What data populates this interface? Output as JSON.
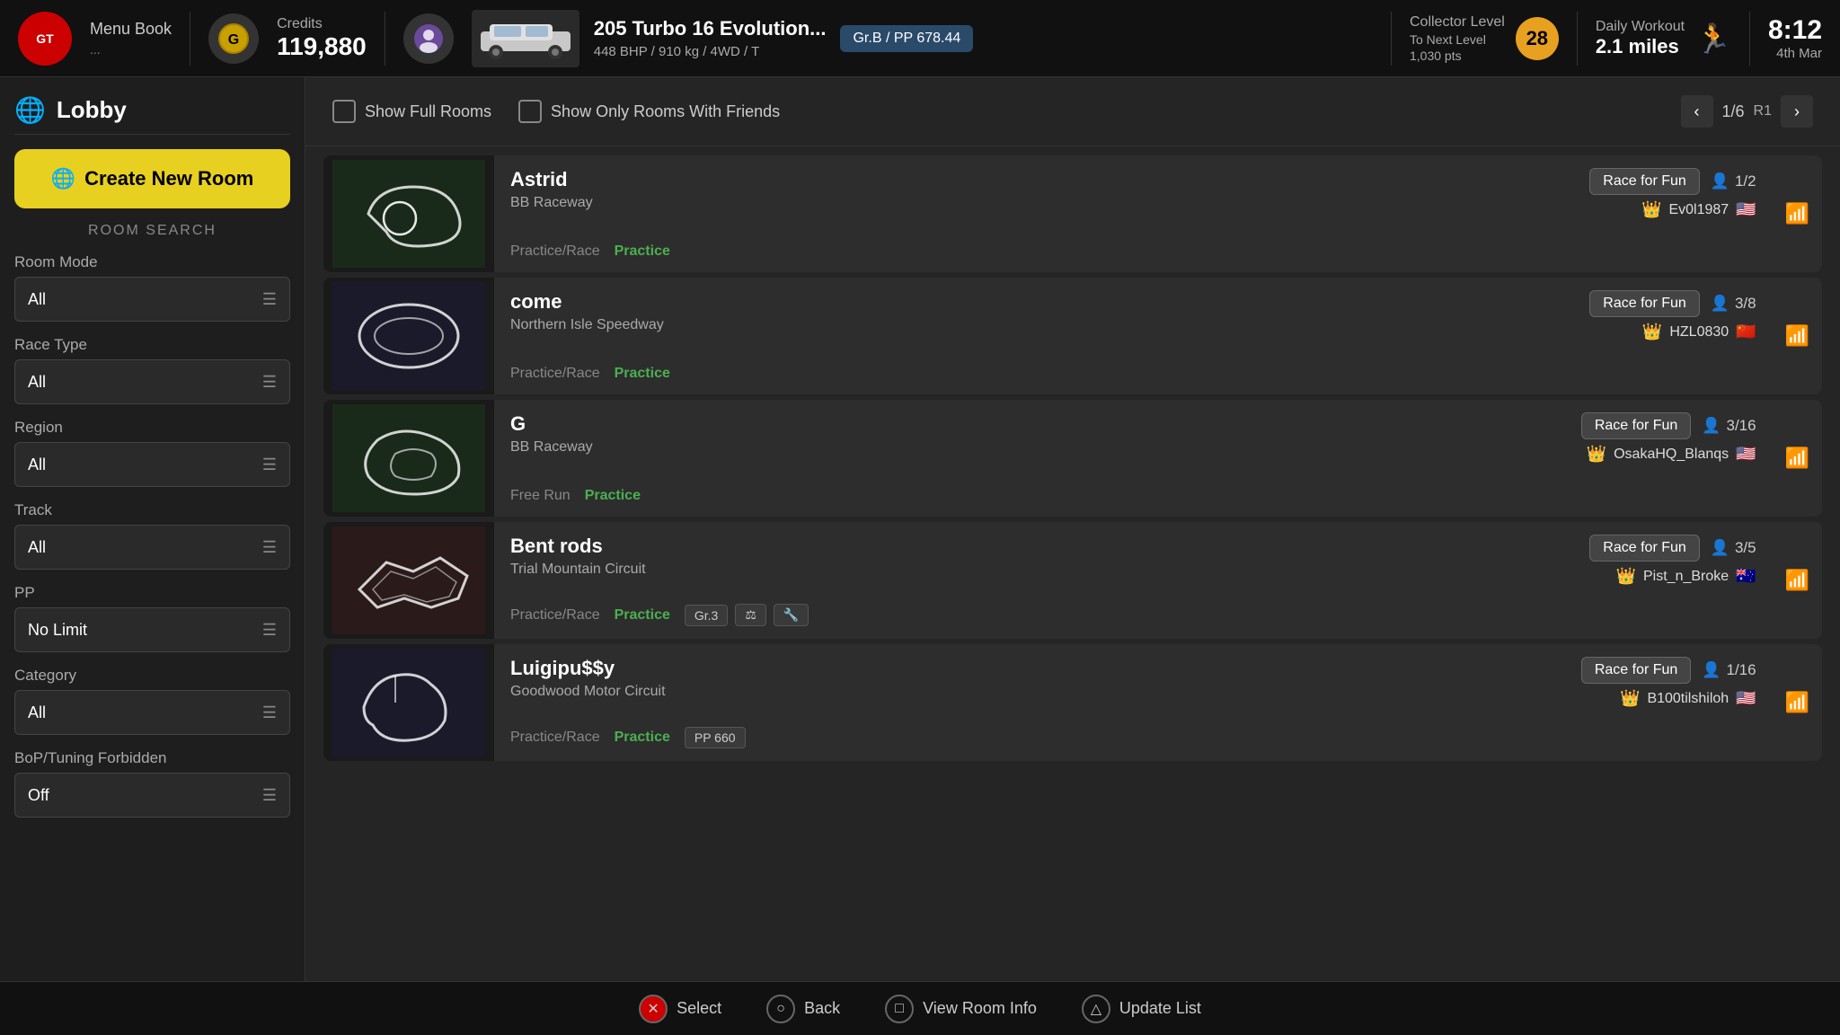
{
  "topbar": {
    "logo": "GT",
    "menu_label": "Menu Book",
    "menu_dots": "...",
    "credits_label": "Credits",
    "credits_value": "119,880",
    "car_name": "205 Turbo 16 Evolution...",
    "car_specs": "448 BHP / 910 kg / 4WD / T",
    "car_grade": "Gr.B / PP 678.44",
    "collector_label": "Collector Level",
    "collector_next": "To Next Level",
    "collector_level": "28",
    "collector_pts": "1,030 pts",
    "workout_label": "Daily Workout",
    "workout_miles": "2.1 miles",
    "workout_date": "4th Mar",
    "time": "8:12"
  },
  "sidebar": {
    "lobby_label": "Lobby",
    "create_room_label": "Create New Room",
    "room_search_label": "ROOM SEARCH",
    "filters": [
      {
        "label": "Room Mode",
        "value": "All"
      },
      {
        "label": "Race Type",
        "value": "All"
      },
      {
        "label": "Region",
        "value": "All"
      },
      {
        "label": "Track",
        "value": "All"
      },
      {
        "label": "PP",
        "value": "No Limit"
      },
      {
        "label": "Category",
        "value": "All"
      },
      {
        "label": "BoP/Tuning Forbidden",
        "value": "Off"
      }
    ]
  },
  "content": {
    "show_full_rooms": "Show Full Rooms",
    "show_friends": "Show Only Rooms With Friends",
    "pagination": "1/6",
    "page_r": "R1",
    "rooms": [
      {
        "name": "Astrid",
        "track": "BB Raceway",
        "type": "Race for Fun",
        "players": "1/2",
        "host": "Ev0l1987",
        "mode": "Practice/Race",
        "status": "Practice",
        "tags": [],
        "flag": "🇺🇸"
      },
      {
        "name": "come",
        "track": "Northern Isle Speedway",
        "type": "Race for Fun",
        "players": "3/8",
        "host": "HZL0830",
        "mode": "Practice/Race",
        "status": "Practice",
        "tags": [],
        "flag": "🇨🇳"
      },
      {
        "name": "G",
        "track": "BB Raceway",
        "type": "Race for Fun",
        "players": "3/16",
        "host": "OsakaHQ_Blanqs",
        "mode": "Free Run",
        "status": "Practice",
        "tags": [],
        "flag": "🇺🇸"
      },
      {
        "name": "Bent rods",
        "track": "Trial Mountain Circuit",
        "type": "Race for Fun",
        "players": "3/5",
        "host": "Pist_n_Broke",
        "mode": "Practice/Race",
        "status": "Practice",
        "tags": [
          "Gr.3",
          "⚖",
          "🔧"
        ],
        "flag": "🇦🇺"
      },
      {
        "name": "Luigipu$$y",
        "track": "Goodwood Motor Circuit",
        "type": "Race for Fun",
        "players": "1/16",
        "host": "B100tilshiloh",
        "mode": "Practice/Race",
        "status": "Practice",
        "tags": [
          "PP 660"
        ],
        "flag": "🇺🇸"
      }
    ]
  },
  "bottom_bar": {
    "select": "Select",
    "back": "Back",
    "view_room": "View Room Info",
    "update": "Update List"
  },
  "icons": {
    "globe": "🌐",
    "crown": "👑",
    "person": "👤",
    "bars": "📶",
    "chevron_left": "‹",
    "chevron_right": "›"
  }
}
